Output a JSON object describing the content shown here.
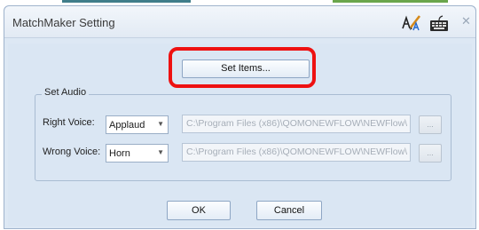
{
  "window": {
    "title": "MatchMaker Setting"
  },
  "icons": {
    "signature": "signature-icon",
    "keyboard": "keyboard-icon",
    "close": "close-icon",
    "close_glyph": "✕"
  },
  "set_items_label": "Set Items...",
  "audio": {
    "group_label": "Set Audio",
    "right": {
      "label": "Right Voice:",
      "selected": "Applaud",
      "path": "C:\\Program Files (x86)\\QOMONEWFLOW\\NEWFlow\\",
      "browse": "..."
    },
    "wrong": {
      "label": "Wrong Voice:",
      "selected": "Horn",
      "path": "C:\\Program Files (x86)\\QOMONEWFLOW\\NEWFlow\\",
      "browse": "..."
    }
  },
  "buttons": {
    "ok": "OK",
    "cancel": "Cancel"
  },
  "colors": {
    "highlight": "#ee1111",
    "window_bg": "#dae6f3"
  }
}
